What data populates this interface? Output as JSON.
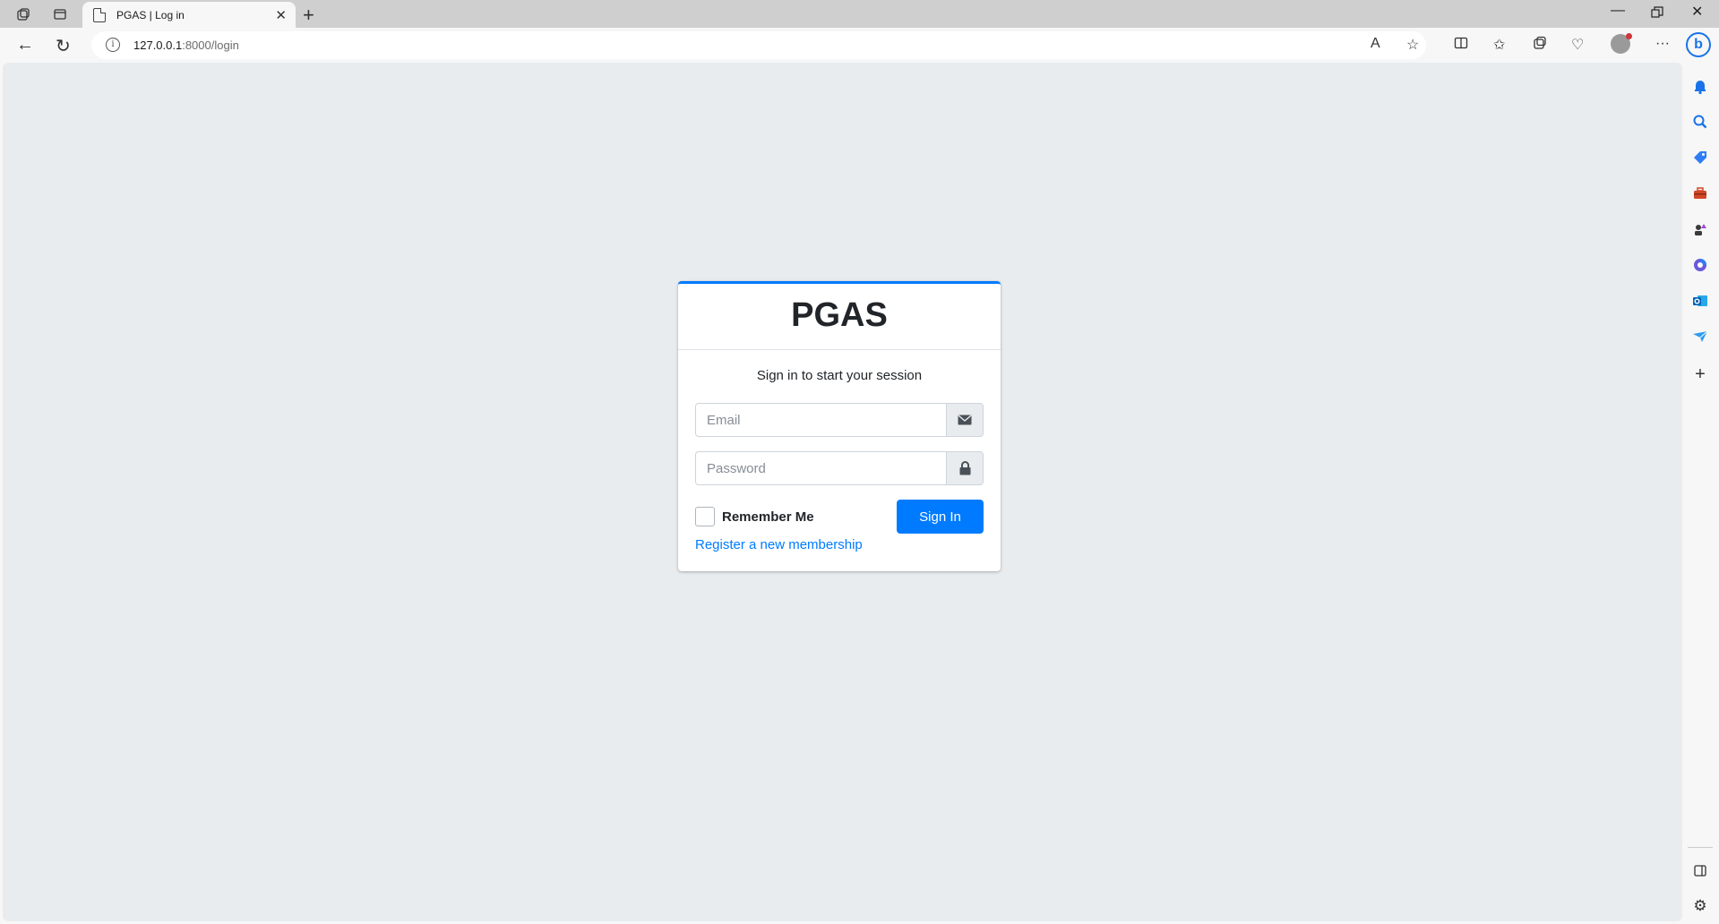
{
  "browser": {
    "tab_title": "PGAS | Log in",
    "url_host": "127.0.0.1",
    "url_path": ":8000/login",
    "colors": {
      "tabbar": "#cfcfcf",
      "accent": "#1a73e8"
    }
  },
  "login": {
    "brand": "PGAS",
    "message": "Sign in to start your session",
    "email_placeholder": "Email",
    "password_placeholder": "Password",
    "remember_label": "Remember Me",
    "sign_in_label": "Sign In",
    "register_link": "Register a new membership",
    "colors": {
      "primary": "#007bff",
      "background": "#e9ecef"
    }
  },
  "sidebar_icons": [
    "bell-icon",
    "search-icon",
    "tag-icon",
    "toolbox-icon",
    "games-icon",
    "office-icon",
    "outlook-icon",
    "send-icon",
    "plus-icon",
    "sidebar-toggle-icon",
    "settings-icon"
  ]
}
